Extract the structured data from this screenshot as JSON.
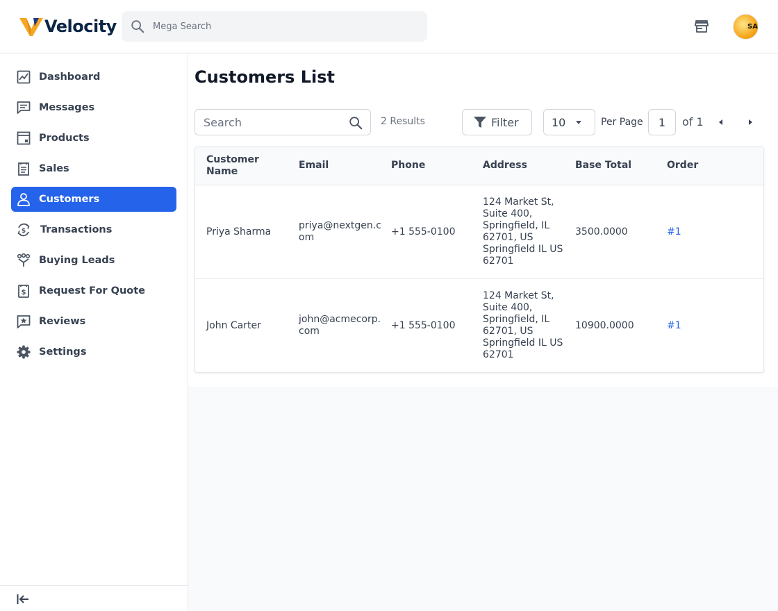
{
  "brand": {
    "name": "Velocity",
    "accent": "#f5a623"
  },
  "header": {
    "search_placeholder": "Mega Search",
    "avatar_text": "SAI"
  },
  "sidebar": {
    "items": [
      {
        "label": "Dashboard",
        "icon": "chart-icon"
      },
      {
        "label": "Messages",
        "icon": "message-icon"
      },
      {
        "label": "Products",
        "icon": "products-icon"
      },
      {
        "label": "Sales",
        "icon": "sales-icon"
      },
      {
        "label": "Customers",
        "icon": "user-icon",
        "active": true
      },
      {
        "label": "Transactions",
        "icon": "transactions-icon"
      },
      {
        "label": "Buying Leads",
        "icon": "leads-icon"
      },
      {
        "label": "Request For Quote",
        "icon": "quote-icon"
      },
      {
        "label": "Reviews",
        "icon": "review-icon"
      },
      {
        "label": "Settings",
        "icon": "gear-icon"
      }
    ],
    "active_color": "#2563eb"
  },
  "main": {
    "title": "Customers List",
    "toolbar": {
      "search_placeholder": "Search",
      "results": "2 Results",
      "filter_label": "Filter",
      "per_page_value": "10",
      "per_page_label": "Per Page",
      "page": "1",
      "page_of": "of 1"
    },
    "table": {
      "headers": [
        "Customer Name",
        "Email",
        "Phone",
        "Address",
        "Base Total",
        "Order"
      ],
      "rows": [
        {
          "name": "Priya Sharma",
          "email": "priya@nextgen.com",
          "phone": "+1 555-0100",
          "address": "124 Market St, Suite 400, Springfield, IL 62701, US Springfield IL US 62701",
          "base_total": "3500.0000",
          "order": "#1"
        },
        {
          "name": "John Carter",
          "email": "john@acmecorp.com",
          "phone": "+1 555-0100",
          "address": "124 Market St, Suite 400, Springfield, IL 62701, US Springfield IL US 62701",
          "base_total": "10900.0000",
          "order": "#1"
        }
      ]
    }
  }
}
